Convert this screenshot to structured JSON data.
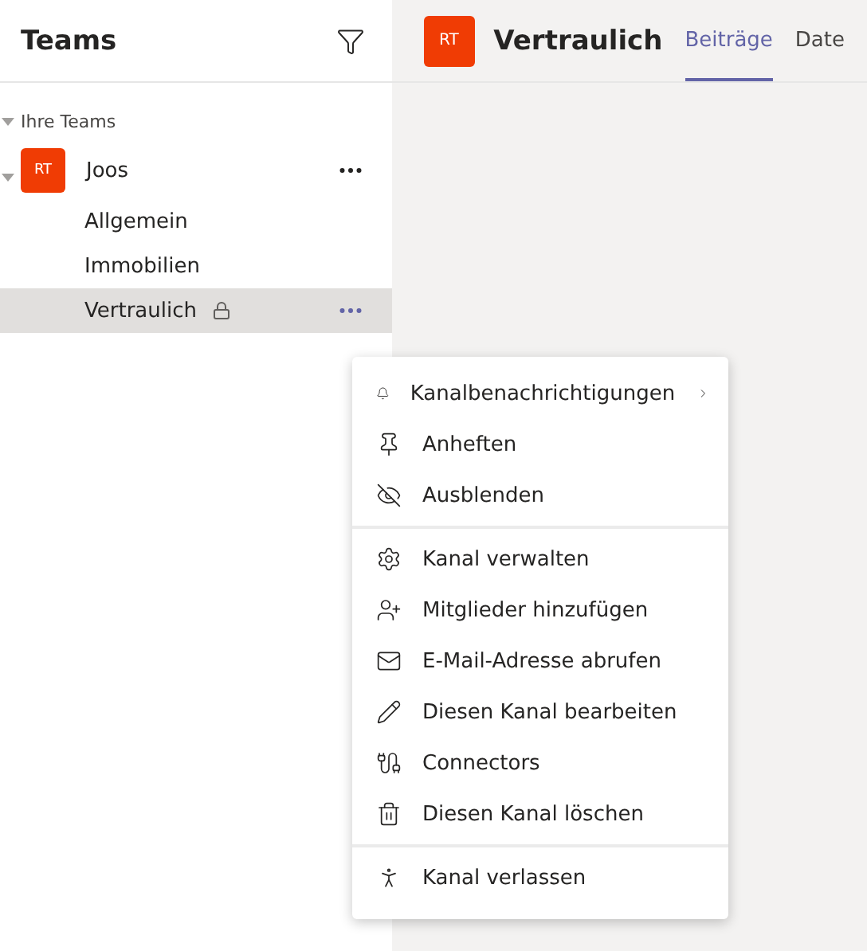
{
  "sidebar": {
    "title": "Teams",
    "section": {
      "label": "Ihre Teams",
      "expanded": true,
      "team": {
        "avatar": "RT",
        "name": "Joos",
        "expanded": true,
        "channels": [
          {
            "name": "Allgemein",
            "selected": false,
            "locked": false
          },
          {
            "name": "Immobilien",
            "selected": false,
            "locked": false
          },
          {
            "name": "Vertraulich",
            "selected": true,
            "locked": true
          }
        ]
      }
    }
  },
  "header": {
    "avatar": "RT",
    "title": "Vertraulich",
    "tabs": [
      {
        "label": "Beiträge",
        "selected": true
      },
      {
        "label": "Date",
        "selected": false
      }
    ]
  },
  "context_menu": {
    "groups": [
      [
        {
          "label": "Kanalbenachrichtigungen",
          "submenu": true
        },
        {
          "label": "Anheften",
          "submenu": false
        },
        {
          "label": "Ausblenden",
          "submenu": false
        }
      ],
      [
        {
          "label": "Kanal verwalten",
          "submenu": false
        },
        {
          "label": "Mitglieder hinzufügen",
          "submenu": false
        },
        {
          "label": "E-Mail-Adresse abrufen",
          "submenu": false
        },
        {
          "label": "Diesen Kanal bearbeiten",
          "submenu": false
        },
        {
          "label": "Connectors",
          "submenu": false
        },
        {
          "label": "Diesen Kanal löschen",
          "submenu": false
        }
      ],
      [
        {
          "label": "Kanal verlassen",
          "submenu": false
        }
      ]
    ]
  }
}
